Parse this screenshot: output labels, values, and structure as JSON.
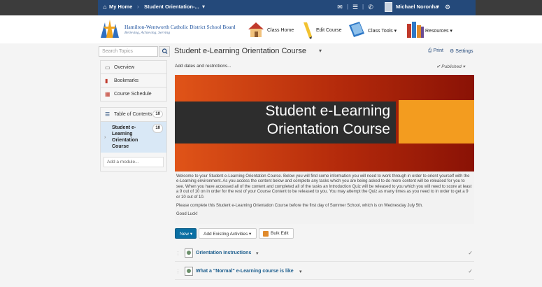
{
  "topbar": {
    "home_label": "My Home",
    "course_label": "Student Orientation-...",
    "user_name": "Michael Noronha"
  },
  "header": {
    "logo_title": "Hamilton-Wentworth Catholic District School Board",
    "logo_tagline": "Believing, Achieving, Serving",
    "nav": [
      {
        "label": "Class Home"
      },
      {
        "label": "Edit Course"
      },
      {
        "label": "Class Tools ▾"
      },
      {
        "label": "Resources ▾"
      }
    ]
  },
  "sidebar": {
    "search_placeholder": "Search Topics",
    "items": [
      {
        "label": "Overview"
      },
      {
        "label": "Bookmarks"
      },
      {
        "label": "Course Schedule"
      }
    ],
    "toc_label": "Table of Contents",
    "toc_count": "10",
    "module_label": "Student e-Learning Orientation Course",
    "module_count": "10",
    "add_module_placeholder": "Add a module..."
  },
  "main": {
    "title": "Student e-Learning Orientation Course",
    "print_label": "Print",
    "settings_label": "Settings",
    "dates_label": "Add dates and restrictions...",
    "status_label": "Published",
    "banner_line1": "Student e-Learning",
    "banner_line2": "Orientation Course",
    "desc_p1": "Welcome to your Student e-Learning Orientation Course.  Below you will find some information you will need to work through in order to orient yourself with the e-Learning environment.  As you access the content below and complete any tasks which you are being asked to do more content will be released for you to see.  When you have accessed all of the content and completed all of the tasks an Introduction Quiz will be released to you which you will need to score at least a 9 out of 10 on in order for the rest of your Course Content to be released to you.  You may attempt the Quiz as many times as you need to in order to get a 9 or 10 out of 10.",
    "desc_p2": "Please complete this Student e-Learning Orientation Course before the first day of Summer School, which is on Wednesday July 5th.",
    "desc_p3": "Good Luck!",
    "btn_new": "New",
    "btn_add": "Add Existing Activities",
    "btn_bulk": "Bulk Edit",
    "items": [
      {
        "label": "Orientation Instructions"
      },
      {
        "label": "What a \"Normal\" e-Learning course is like"
      }
    ]
  },
  "colors": {
    "nav_blue": "#24497a",
    "accent_blue": "#0a6fa3",
    "banner_orange": "#e05418",
    "banner_accent": "#f39c1f"
  }
}
